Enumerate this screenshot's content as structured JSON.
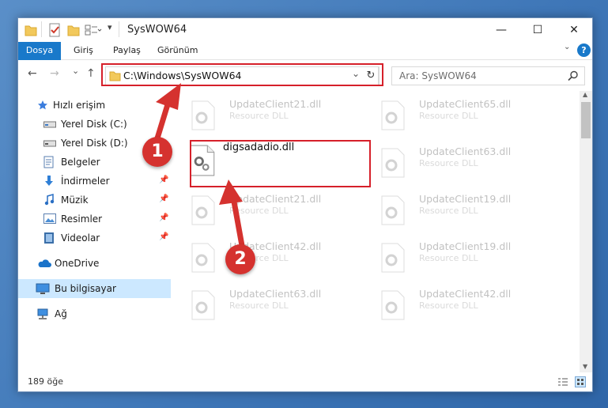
{
  "window": {
    "title": "SysWOW64",
    "controls": {
      "minimize": "—",
      "maximize": "☐",
      "close": "✕"
    }
  },
  "ribbon": {
    "tabs": [
      "Dosya",
      "Giriş",
      "Paylaş",
      "Görünüm"
    ],
    "help": "?"
  },
  "nav": {
    "back": "←",
    "forward": "→",
    "recent": "⌄",
    "up": "↑",
    "address": "C:\\Windows\\SysWOW64",
    "address_dropdown": "⌄",
    "refresh": "↻",
    "search_placeholder": "Ara: SysWOW64",
    "search_icon": "search-icon"
  },
  "sidebar": {
    "items": [
      {
        "label": "Hızlı erişim",
        "icon": "star-icon"
      },
      {
        "label": "Yerel Disk (C:)",
        "icon": "drive-icon"
      },
      {
        "label": "Yerel Disk (D:)",
        "icon": "drive-icon"
      },
      {
        "label": "Belgeler",
        "icon": "documents-icon"
      },
      {
        "label": "İndirmeler",
        "icon": "download-icon"
      },
      {
        "label": "Müzik",
        "icon": "music-icon"
      },
      {
        "label": "Resimler",
        "icon": "pictures-icon"
      },
      {
        "label": "Videolar",
        "icon": "videos-icon"
      },
      {
        "label": "OneDrive",
        "icon": "cloud-icon"
      },
      {
        "label": "Bu bilgisayar",
        "icon": "computer-icon"
      },
      {
        "label": "Ağ",
        "icon": "network-icon"
      }
    ],
    "pin_icon": "pin-icon"
  },
  "files": {
    "main": {
      "name": "digsadadio.dll"
    },
    "background": [
      {
        "name": "UpdateClient21.dll",
        "type": "Resource DLL"
      },
      {
        "name": "UpdateClient65.dll",
        "type": "Resource DLL"
      },
      {
        "name": "UpdateClient63.dll",
        "type": "Resource DLL"
      },
      {
        "name": "UpdateClient21.dll",
        "type": "Resource DLL"
      },
      {
        "name": "UpdateClient19.dll",
        "type": "Resource DLL"
      },
      {
        "name": "UpdateClient42.dll",
        "type": "Resource DLL"
      },
      {
        "name": "UpdateClient19.dll",
        "type": "Resource DLL"
      },
      {
        "name": "UpdateClient63.dll",
        "type": "Resource DLL"
      },
      {
        "name": "UpdateClient42.dll",
        "type": "Resource DLL"
      }
    ]
  },
  "status": {
    "count": "189 öğe"
  },
  "annotations": {
    "marker1": "1",
    "marker2": "2"
  },
  "colors": {
    "accent": "#1979ca",
    "highlight": "#d6202a",
    "selected": "#cce8ff"
  }
}
